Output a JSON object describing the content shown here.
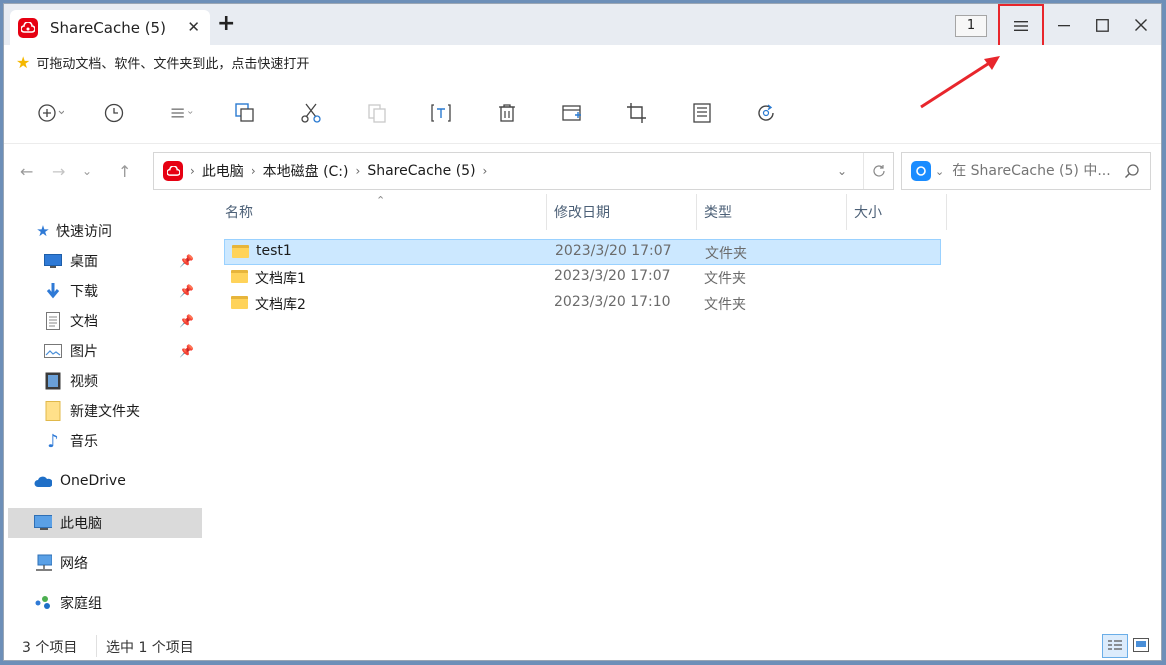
{
  "window": {
    "tab_title": "ShareCache (5)",
    "tab_close": "✕",
    "new_tab": "+",
    "badge": "1",
    "brand_color": "#e60012"
  },
  "hint_bar": {
    "icon": "star-icon",
    "text": "可拖动文档、软件、文件夹到此，点击快速打开"
  },
  "toolbar": {
    "icons": [
      "new-add-icon",
      "history-icon",
      "view-menu-icon",
      "copy-icon",
      "cut-icon",
      "paste-icon",
      "rename-icon",
      "delete-icon",
      "new-folder-icon",
      "crop-icon",
      "properties-icon",
      "refresh-icon"
    ]
  },
  "address": {
    "breadcrumb": [
      "此电脑",
      "本地磁盘 (C:)",
      "ShareCache (5)"
    ],
    "search_placeholder": "在 ShareCache (5) 中..."
  },
  "sidebar": {
    "quick_access": "快速访问",
    "items": [
      {
        "label": "桌面",
        "icon": "desktop-icon",
        "pinned": true
      },
      {
        "label": "下载",
        "icon": "download-icon",
        "pinned": true
      },
      {
        "label": "文档",
        "icon": "document-icon",
        "pinned": true
      },
      {
        "label": "图片",
        "icon": "picture-icon",
        "pinned": true
      },
      {
        "label": "视频",
        "icon": "video-icon",
        "pinned": false
      },
      {
        "label": "新建文件夹",
        "icon": "folder-icon",
        "pinned": false
      },
      {
        "label": "音乐",
        "icon": "music-icon",
        "pinned": false
      }
    ],
    "onedrive": "OneDrive",
    "this_pc": "此电脑",
    "network": "网络",
    "homegroup": "家庭组"
  },
  "list": {
    "columns": [
      "名称",
      "修改日期",
      "类型",
      "大小"
    ],
    "rows": [
      {
        "name": "test1",
        "date": "2023/3/20 17:07",
        "type": "文件夹",
        "selected": true
      },
      {
        "name": "文档库1",
        "date": "2023/3/20 17:07",
        "type": "文件夹",
        "selected": false
      },
      {
        "name": "文档库2",
        "date": "2023/3/20 17:10",
        "type": "文件夹",
        "selected": false
      }
    ]
  },
  "status": {
    "count": "3 个项目",
    "selected": "选中 1 个项目"
  },
  "colors": {
    "selection_bg": "#cce8ff",
    "highlight_box": "#e8262c"
  }
}
